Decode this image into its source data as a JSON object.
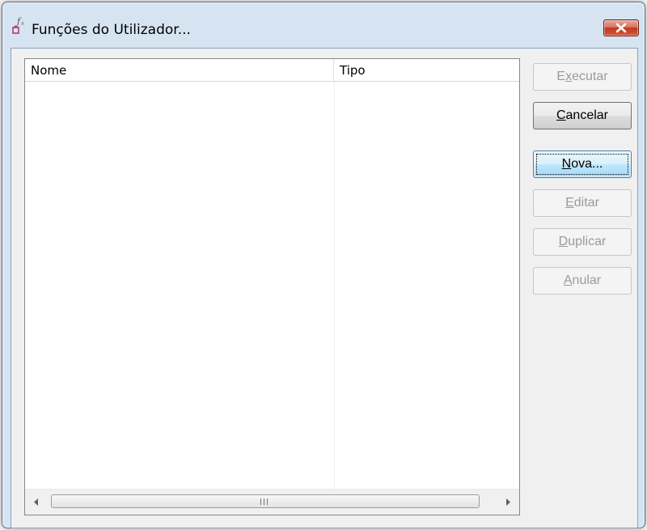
{
  "window": {
    "title": "Funções do Utilizador...",
    "icon": "function-fx-icon",
    "close_icon": "close-icon"
  },
  "list": {
    "columns": [
      "Nome",
      "Tipo"
    ],
    "rows": []
  },
  "scrollbar": {
    "left_icon": "arrow-left-icon",
    "right_icon": "arrow-right-icon",
    "grip_icon": "grip-icon"
  },
  "buttons": [
    {
      "label": "Executar",
      "mnemonic_index": 1,
      "enabled": false
    },
    {
      "label": "Cancelar",
      "mnemonic_index": 0,
      "enabled": true
    },
    {
      "label": "Nova...",
      "mnemonic_index": 0,
      "enabled": true,
      "default": true
    },
    {
      "label": "Editar",
      "mnemonic_index": 0,
      "enabled": false
    },
    {
      "label": "Duplicar",
      "mnemonic_index": 0,
      "enabled": false
    },
    {
      "label": "Anular",
      "mnemonic_index": 0,
      "enabled": false
    }
  ],
  "colors": {
    "frame": "#d6e4f2",
    "client": "#f0f0f0",
    "close": "#c0391f",
    "default_button": "#bee6fd"
  }
}
